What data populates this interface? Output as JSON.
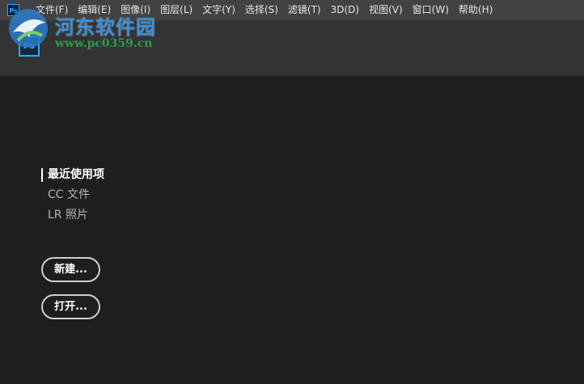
{
  "app": {
    "icon_label": "Ps"
  },
  "menu": {
    "items": [
      {
        "label": "文件(F)"
      },
      {
        "label": "编辑(E)"
      },
      {
        "label": "图像(I)"
      },
      {
        "label": "图层(L)"
      },
      {
        "label": "文字(Y)"
      },
      {
        "label": "选择(S)"
      },
      {
        "label": "滤镜(T)"
      },
      {
        "label": "3D(D)"
      },
      {
        "label": "视图(V)"
      },
      {
        "label": "窗口(W)"
      },
      {
        "label": "帮助(H)"
      }
    ]
  },
  "watermark": {
    "title": "河东软件园",
    "url": "www.pc0359.cn"
  },
  "start": {
    "nav": [
      {
        "label": "最近使用项",
        "active": true
      },
      {
        "label": "CC 文件",
        "active": false
      },
      {
        "label": "LR 照片",
        "active": false
      }
    ],
    "new_button": "新建...",
    "open_button": "打开..."
  },
  "colors": {
    "accent": "#31a8ff",
    "menubar": "#424242",
    "background": "#1e1e1e"
  }
}
